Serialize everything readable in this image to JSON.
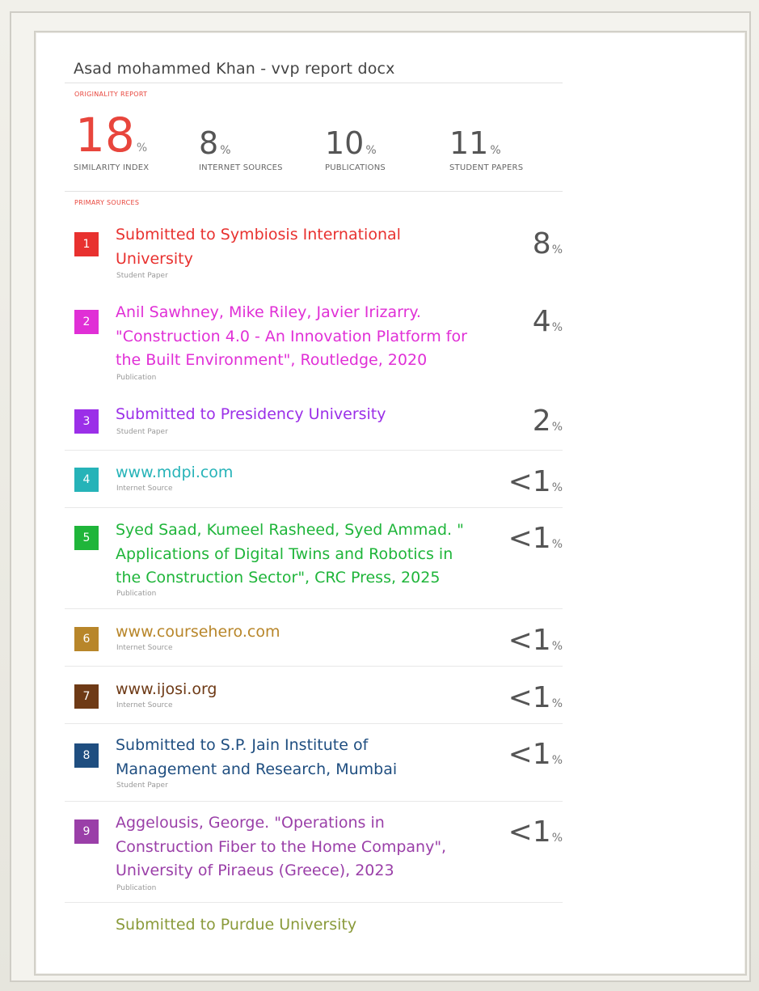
{
  "document": {
    "title": "Asad mohammed Khan - vvp report docx",
    "originality_label": "ORIGINALITY REPORT",
    "primary_sources_label": "PRIMARY SOURCES"
  },
  "summary": [
    {
      "value": "18",
      "unit": "%",
      "label": "SIMILARITY INDEX"
    },
    {
      "value": "8",
      "unit": "%",
      "label": "INTERNET SOURCES"
    },
    {
      "value": "10",
      "unit": "%",
      "label": "PUBLICATIONS"
    },
    {
      "value": "11",
      "unit": "%",
      "label": "STUDENT PAPERS"
    }
  ],
  "sources": [
    {
      "rank": "1",
      "color": "#e8312f",
      "lines": [
        "Submitted to Symbiosis International",
        "University"
      ],
      "type": "Student Paper",
      "percent": "8",
      "unit": "%"
    },
    {
      "rank": "2",
      "color": "#e02fd6",
      "lines": [
        "Anil Sawhney, Mike Riley, Javier Irizarry.",
        "\"Construction 4.0 - An Innovation Platform for",
        "the Built Environment\", Routledge, 2020"
      ],
      "type": "Publication",
      "percent": "4",
      "unit": "%"
    },
    {
      "rank": "3",
      "color": "#9b2fe8",
      "lines": [
        "Submitted to Presidency University"
      ],
      "type": "Student Paper",
      "percent": "2",
      "unit": "%"
    },
    {
      "rank": "4",
      "color": "#26b3b8",
      "lines": [
        "www.mdpi.com"
      ],
      "type": "Internet Source",
      "percent": "<1",
      "unit": "%"
    },
    {
      "rank": "5",
      "color": "#1fb53a",
      "lines": [
        "Syed Saad, Kumeel Rasheed, Syed Ammad. \"",
        "Applications of Digital Twins and Robotics in",
        "the Construction Sector\", CRC Press, 2025"
      ],
      "type": "Publication",
      "percent": "<1",
      "unit": "%"
    },
    {
      "rank": "6",
      "color": "#b8862a",
      "lines": [
        "www.coursehero.com"
      ],
      "type": "Internet Source",
      "percent": "<1",
      "unit": "%"
    },
    {
      "rank": "7",
      "color": "#6e3a16",
      "lines": [
        "www.ijosi.org"
      ],
      "type": "Internet Source",
      "percent": "<1",
      "unit": "%"
    },
    {
      "rank": "8",
      "color": "#1f4e80",
      "lines": [
        "Submitted to S.P. Jain Institute of",
        "Management and Research, Mumbai"
      ],
      "type": "Student Paper",
      "percent": "<1",
      "unit": "%"
    },
    {
      "rank": "9",
      "color": "#9a3fa8",
      "lines": [
        "Aggelousis, George. \"Operations in",
        "Construction Fiber to the Home Company\",",
        "University of Piraeus (Greece), 2023"
      ],
      "type": "Publication",
      "percent": "<1",
      "unit": "%"
    },
    {
      "rank": "",
      "color": "#8a9a3a",
      "lines": [
        "Submitted to Purdue University"
      ],
      "type": "",
      "percent": "",
      "unit": ""
    }
  ]
}
